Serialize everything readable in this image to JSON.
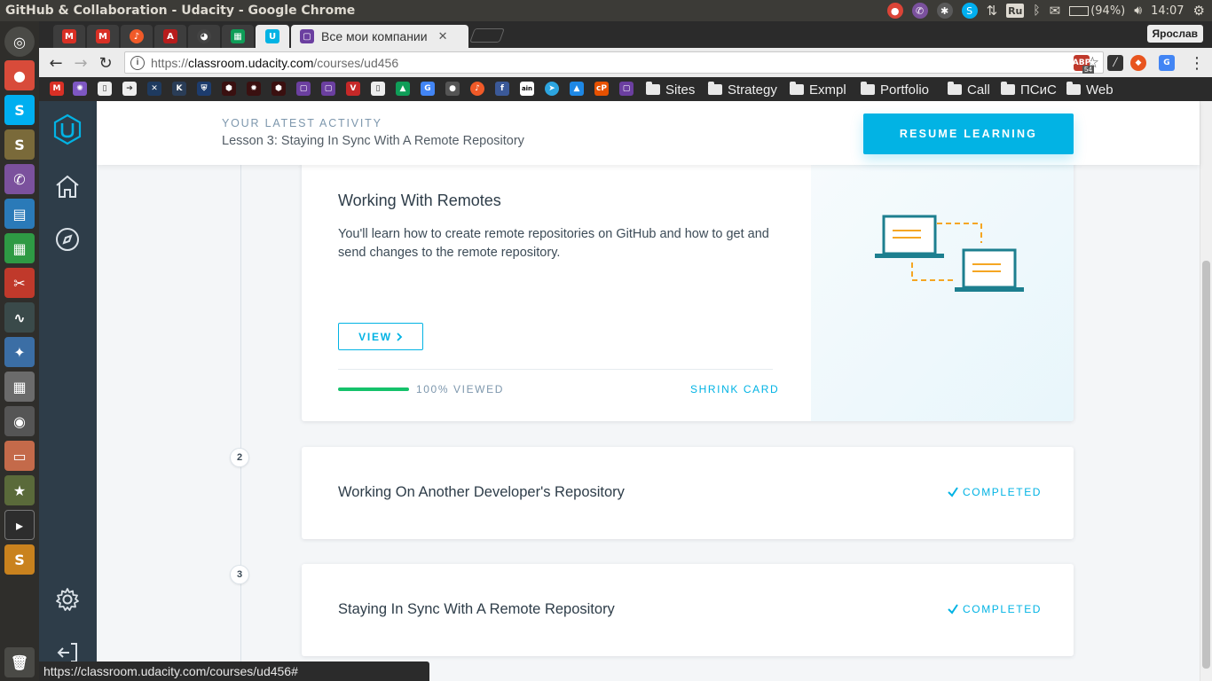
{
  "os": {
    "window_title": "GitHub & Collaboration - Udacity - Google Chrome",
    "battery": "(94%)",
    "time": "14:07",
    "keyboard_layout": "Ru"
  },
  "browser": {
    "active_tab_title": "Все мои компании",
    "profile_name": "Ярослав",
    "url": {
      "scheme": "https://",
      "host": "classroom.udacity.com",
      "path": "/courses/ud456"
    },
    "extension_badge": "54",
    "bookmark_folders": [
      "Sites",
      "Strategy",
      "Exmpl",
      "Portfolio",
      "Call",
      "ПСиС",
      "Web"
    ],
    "status_url": "https://classroom.udacity.com/courses/ud456#"
  },
  "activity": {
    "label": "YOUR LATEST ACTIVITY",
    "lesson": "Lesson 3: Staying In Sync With A Remote Repository",
    "resume_label": "RESUME LEARNING"
  },
  "lessons": [
    {
      "title": "Working With Remotes",
      "description": "You'll learn how to create remote repositories on GitHub and how to get and send changes to the remote repository.",
      "view_label": "VIEW",
      "progress_label": "100% VIEWED",
      "progress_fraction": 1.0,
      "shrink_label": "SHRINK CARD"
    },
    {
      "number": "2",
      "title": "Working On Another Developer's Repository",
      "status": "COMPLETED"
    },
    {
      "number": "3",
      "title": "Staying In Sync With A Remote Repository",
      "status": "COMPLETED"
    }
  ],
  "colors": {
    "udacity_blue": "#02b3e4",
    "sidebar": "#2e3d49",
    "progress_green": "#15c26b",
    "illustration_teal": "#1d7f8f",
    "illustration_orange": "#f5a623"
  }
}
